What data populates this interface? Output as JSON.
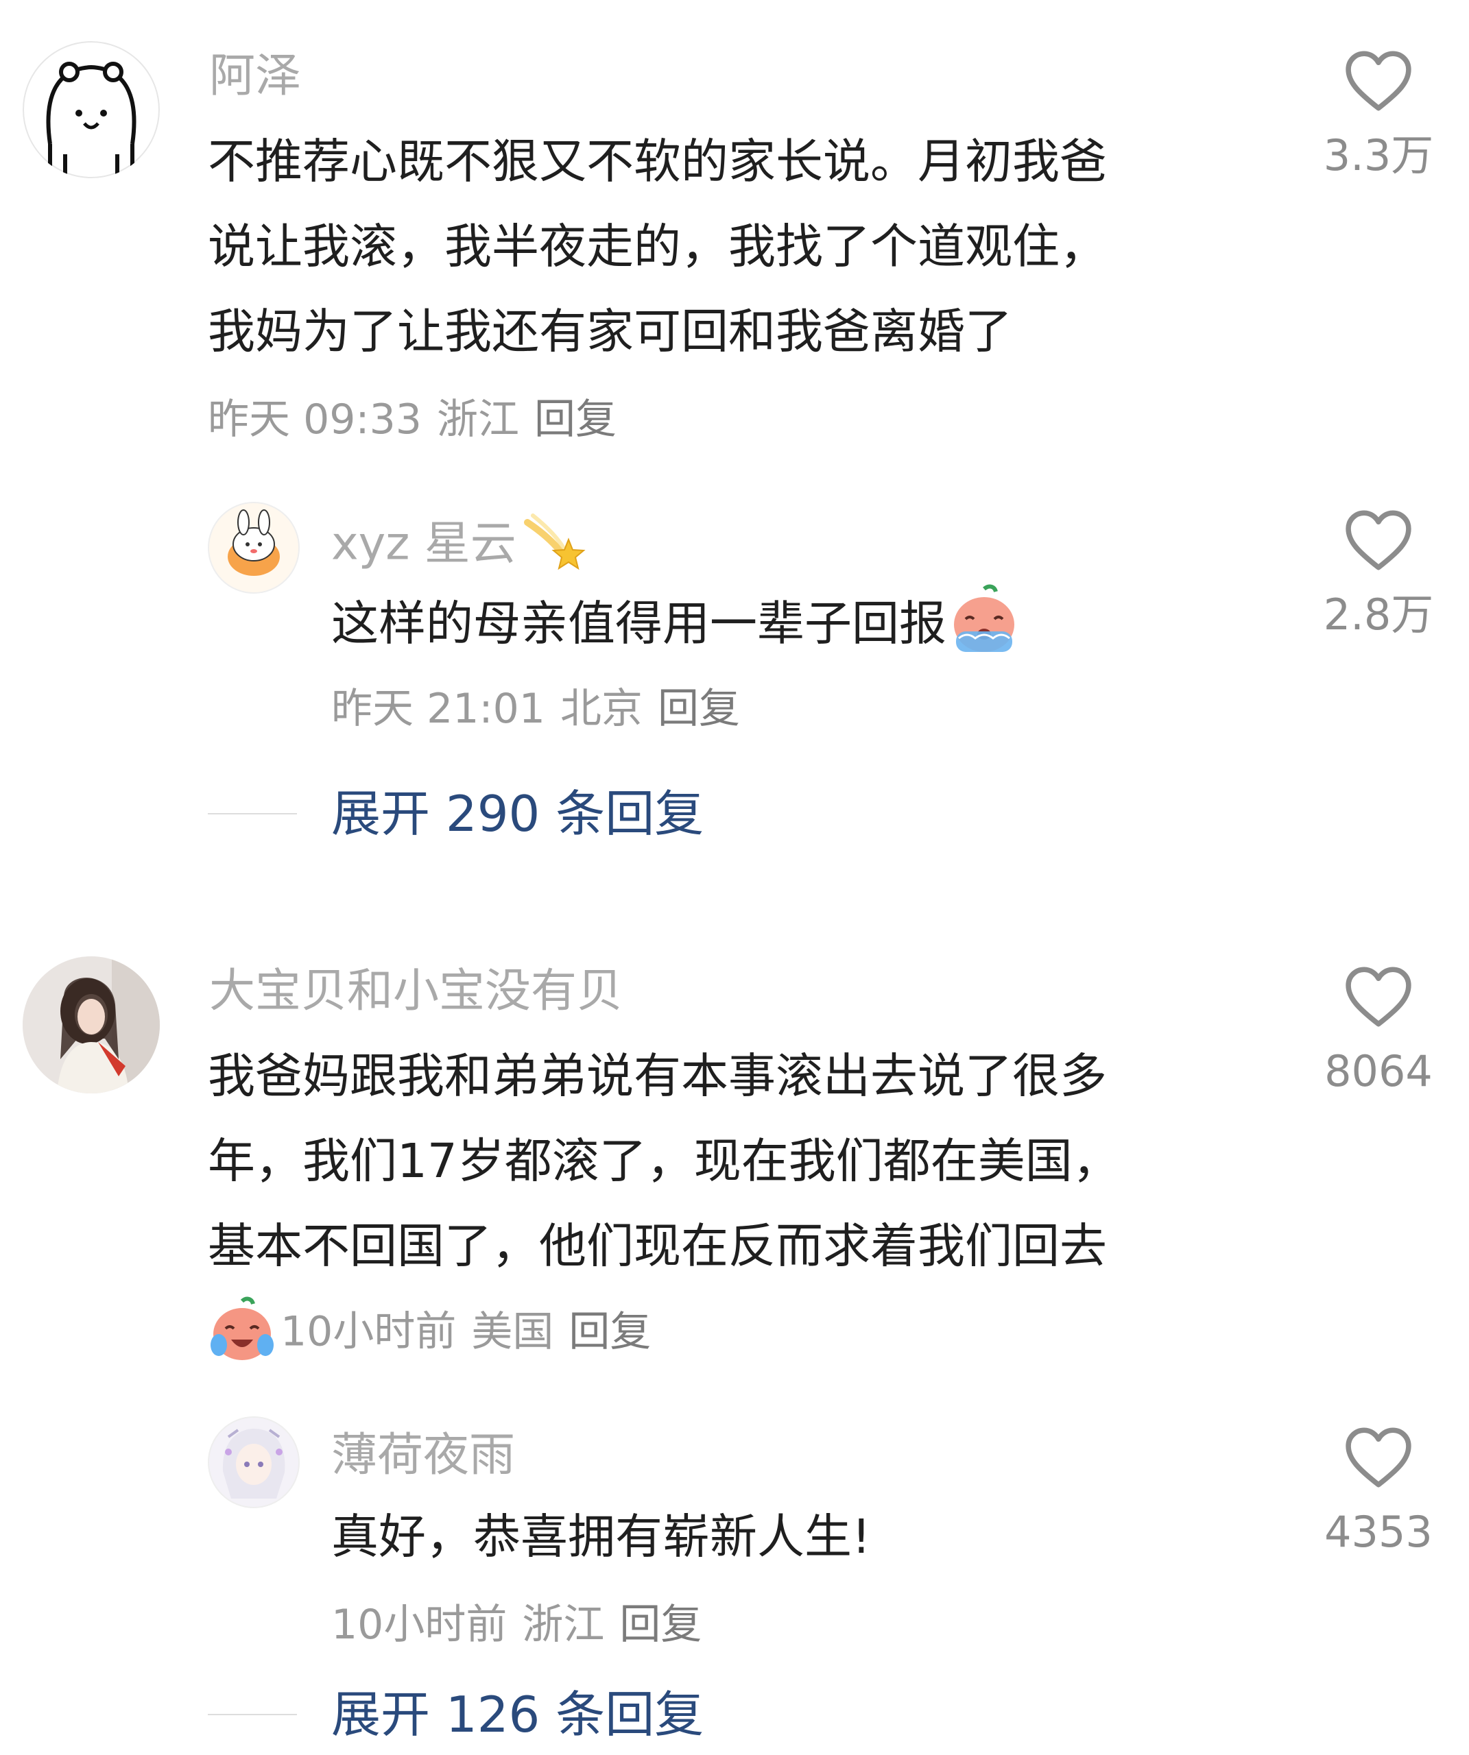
{
  "comments": [
    {
      "username": "阿泽",
      "avatar_icon": "cartoon-bear-avatar",
      "lines": [
        "不推荐心既不狠又不软的家长说。月初我爸",
        "说让我滚，我半夜走的，我找了个道观住，",
        "我妈为了让我还有家可回和我爸离婚了"
      ],
      "time": "昨天 09:33",
      "location": "浙江",
      "reply_label": "回复",
      "likes": "3.3万",
      "replies": [
        {
          "username": "xyz 星云",
          "username_emoji": "shooting-star-emoji",
          "avatar_icon": "cartoon-rabbit-avatar",
          "text": "这样的母亲值得用一辈子回报",
          "text_emoji": "crying-face-emoji",
          "time": "昨天 21:01",
          "location": "北京",
          "reply_label": "回复",
          "likes": "2.8万"
        }
      ],
      "expand_label": "展开 290 条回复"
    },
    {
      "username": "大宝贝和小宝没有贝",
      "avatar_icon": "photo-woman-avatar",
      "lines": [
        "我爸妈跟我和弟弟说有本事滚出去说了很多",
        "年，我们17岁都滚了，现在我们都在美国，",
        "基本不回国了，他们现在反而求着我们回去"
      ],
      "meta_emoji": "laughing-crying-face-emoji",
      "time": "10小时前",
      "location": "美国",
      "reply_label": "回复",
      "likes": "8064",
      "replies": [
        {
          "username": "薄荷夜雨",
          "avatar_icon": "anime-girl-avatar",
          "text": "真好，恭喜拥有崭新人生!",
          "time": "10小时前",
          "location": "浙江",
          "reply_label": "回复",
          "likes": "4353"
        }
      ],
      "expand_label": "展开 126 条回复"
    }
  ],
  "colors": {
    "username": "#a9a9a9",
    "comment_text": "#1f1f1f",
    "meta": "#9a9a9a",
    "expand_link": "#2a4a7c",
    "like_count": "#8c8c8c"
  }
}
